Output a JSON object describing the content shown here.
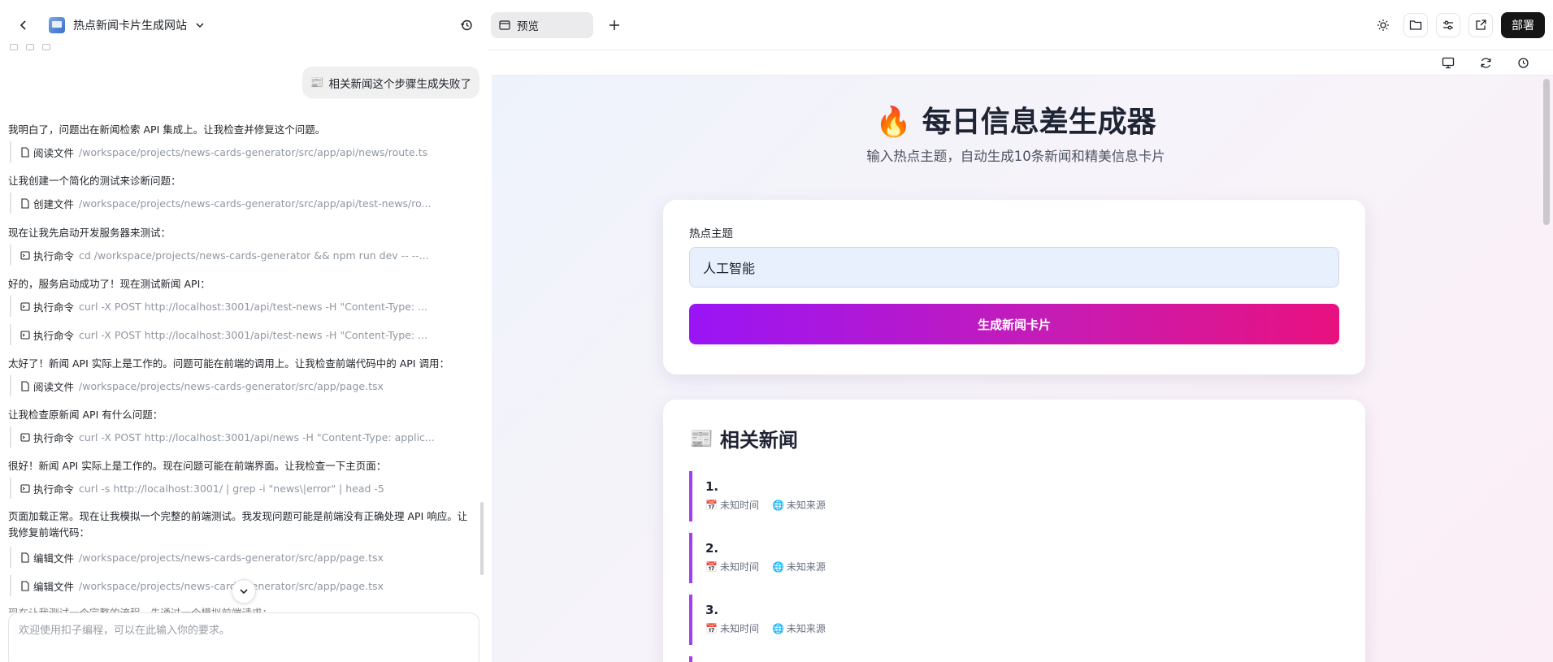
{
  "left_panel": {
    "app_title": "热点新闻卡片生成网站",
    "user_message_emoji": "📰",
    "user_message": "相关新闻这个步骤生成失败了",
    "messages": [
      "我明白了，问题出在新闻检索 API 集成上。让我检查并修复这个问题。",
      "让我创建一个简化的测试来诊断问题：",
      "现在让我先启动开发服务器来测试：",
      "好的，服务启动成功了！现在测试新闻 API：",
      "太好了！新闻 API 实际上是工作的。问题可能在前端的调用上。让我检查前端代码中的 API 调用：",
      "让我检查原新闻 API 有什么问题：",
      "很好！新闻 API 实际上是工作的。现在问题可能在前端界面。让我检查一下主页面：",
      "页面加载正常。现在让我模拟一个完整的前端测试。我发现问题可能是前端没有正确处理 API 响应。让我修复前端代码：",
      "现在让我测试一个完整的流程。先通过一个模拟前端请求："
    ],
    "tools": [
      {
        "icon": "file-icon",
        "name": "阅读文件",
        "path": "/workspace/projects/news-cards-generator/src/app/api/news/route.ts"
      },
      {
        "icon": "file-icon",
        "name": "创建文件",
        "path": "/workspace/projects/news-cards-generator/src/app/api/test-news/ro..."
      },
      {
        "icon": "terminal-icon",
        "name": "执行命令",
        "path": "cd /workspace/projects/news-cards-generator && npm run dev -- --..."
      },
      {
        "icon": "terminal-icon",
        "name": "执行命令",
        "path": "curl -X POST http://localhost:3001/api/test-news -H \"Content-Type: ..."
      },
      {
        "icon": "terminal-icon",
        "name": "执行命令",
        "path": "curl -X POST http://localhost:3001/api/test-news -H \"Content-Type: ..."
      },
      {
        "icon": "file-icon",
        "name": "阅读文件",
        "path": "/workspace/projects/news-cards-generator/src/app/page.tsx"
      },
      {
        "icon": "terminal-icon",
        "name": "执行命令",
        "path": "curl -X POST http://localhost:3001/api/news -H \"Content-Type: applic..."
      },
      {
        "icon": "terminal-icon",
        "name": "执行命令",
        "path": "curl -s http://localhost:3001/ | grep -i \"news\\|error\" | head -5"
      },
      {
        "icon": "file-icon",
        "name": "编辑文件",
        "path": "/workspace/projects/news-cards-generator/src/app/page.tsx"
      },
      {
        "icon": "file-icon",
        "name": "编辑文件",
        "path": "/workspace/projects/news-cards-generator/src/app/page.tsx"
      }
    ],
    "composer_placeholder": "欢迎使用扣子编程，可以在此输入你的要求。"
  },
  "right_panel": {
    "tab_label": "预览",
    "deploy_label": "部署",
    "page": {
      "title_emoji": "🔥",
      "title": "每日信息差生成器",
      "subtitle": "输入热点主题，自动生成10条新闻和精美信息卡片",
      "input_label": "热点主题",
      "input_value": "人工智能",
      "generate_button": "生成新闻卡片",
      "news_heading_emoji": "📰",
      "news_heading": "相关新闻",
      "news_items": [
        {
          "num": "1.",
          "time_emoji": "📅",
          "time": "未知时间",
          "source_emoji": "🌐",
          "source": "未知来源"
        },
        {
          "num": "2.",
          "time_emoji": "📅",
          "time": "未知时间",
          "source_emoji": "🌐",
          "source": "未知来源"
        },
        {
          "num": "3.",
          "time_emoji": "📅",
          "time": "未知时间",
          "source_emoji": "🌐",
          "source": "未知来源"
        }
      ]
    }
  },
  "colors": {
    "accent_gradient_start": "#9a14f6",
    "accent_gradient_end": "#e8117f",
    "news_border": "#a23ff0",
    "deploy_bg": "#151515"
  }
}
